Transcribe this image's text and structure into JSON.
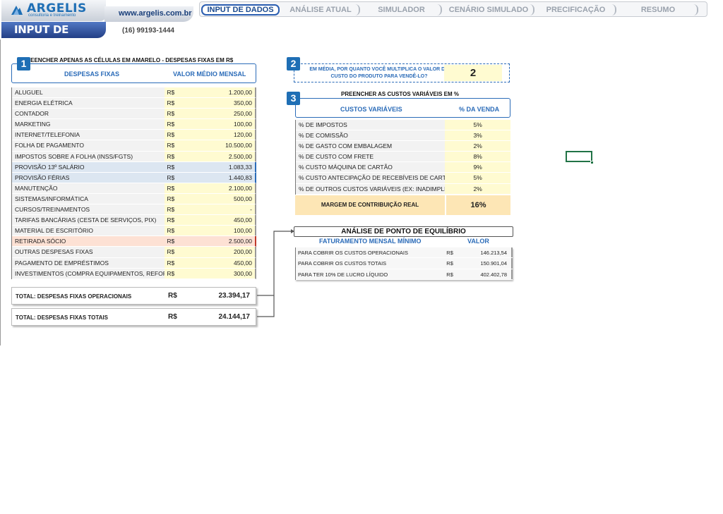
{
  "header": {
    "logo_text": "ARGELIS",
    "logo_subtext": "consultoria e treinamento",
    "website": "www.argelis.com.br",
    "page_title": "INPUT DE DADOS",
    "phone": "(16) 99193-1444"
  },
  "tabs": [
    {
      "label": "INPUT DE DADOS",
      "active": true
    },
    {
      "label": "ANÁLISE ATUAL",
      "active": false
    },
    {
      "label": "SIMULADOR",
      "active": false
    },
    {
      "label": "CENÁRIO SIMULADO",
      "active": false
    },
    {
      "label": "PRECIFICAÇÃO",
      "active": false
    },
    {
      "label": "RESUMO",
      "active": false
    }
  ],
  "section1": {
    "number": "1",
    "title": "PREENCHER APENAS AS CÉLULAS EM AMARELO - DESPESAS FIXAS EM R$",
    "col_name": "DESPESAS FIXAS",
    "col_value": "VALOR MÉDIO MENSAL",
    "currency": "R$",
    "rows": [
      {
        "name": "ALUGUEL",
        "value": "1.200,00",
        "style": "yellow"
      },
      {
        "name": "ENERGIA ELÉTRICA",
        "value": "350,00",
        "style": "yellow"
      },
      {
        "name": "CONTADOR",
        "value": "250,00",
        "style": "yellow"
      },
      {
        "name": "MARKETING",
        "value": "100,00",
        "style": "yellow"
      },
      {
        "name": "INTERNET/TELEFONIA",
        "value": "120,00",
        "style": "yellow"
      },
      {
        "name": "FOLHA DE PAGAMENTO",
        "value": "10.500,00",
        "style": "yellow"
      },
      {
        "name": "IMPOSTOS SOBRE A FOLHA (INSS/FGTS)",
        "value": "2.500,00",
        "style": "yellow"
      },
      {
        "name": "PROVISÃO 13º SALÁRIO",
        "value": "1.083,33",
        "style": "blue"
      },
      {
        "name": "PROVISÃO FÉRIAS",
        "value": "1.440,83",
        "style": "blue"
      },
      {
        "name": "MANUTENÇÃO",
        "value": "2.100,00",
        "style": "yellow"
      },
      {
        "name": "SISTEMAS/INFORMÁTICA",
        "value": "500,00",
        "style": "yellow"
      },
      {
        "name": "CURSOS/TREINAMENTOS",
        "value": "-",
        "style": "yellow"
      },
      {
        "name": "TARIFAS BANCÁRIAS (CESTA DE SERVIÇOS, PIX)",
        "value": "450,00",
        "style": "yellow"
      },
      {
        "name": "MATERIAL DE ESCRITÓRIO",
        "value": "100,00",
        "style": "yellow"
      },
      {
        "name": "RETIRADA SÓCIO",
        "value": "2.500,00",
        "style": "red"
      },
      {
        "name": "OUTRAS DESPESAS FIXAS",
        "value": "200,00",
        "style": "yellow"
      },
      {
        "name": "PAGAMENTO DE EMPRÉSTIMOS",
        "value": "450,00",
        "style": "yellow"
      },
      {
        "name": "INVESTIMENTOS (COMPRA EQUIPAMENTOS, REFORMAS)",
        "value": "300,00",
        "style": "yellow"
      }
    ],
    "total_operational_label": "TOTAL: DESPESAS FIXAS OPERACIONAIS",
    "total_operational_value": "23.394,17",
    "total_label": "TOTAL: DESPESAS FIXAS TOTAIS",
    "total_value": "24.144,17"
  },
  "section2": {
    "number": "2",
    "question": "EM MÉDIA, POR QUANTO VOCÊ MULTIPLICA O VALOR DO CUSTO DO PRODUTO PARA VENDÊ-LO?",
    "value": "2"
  },
  "section3": {
    "number": "3",
    "title": "PREENCHER AS CUSTOS VARIÁVEIS EM %",
    "col_name": "CUSTOS VARIÁVEIS",
    "col_value": "% DA VENDA",
    "rows": [
      {
        "name": "% DE IMPOSTOS",
        "value": "5%"
      },
      {
        "name": "% DE COMISSÃO",
        "value": "3%"
      },
      {
        "name": "% DE GASTO COM EMBALAGEM",
        "value": "2%"
      },
      {
        "name": "% DE CUSTO COM FRETE",
        "value": "8%"
      },
      {
        "name": "% CUSTO MÁQUINA DE CARTÃO",
        "value": "9%"
      },
      {
        "name": "% CUSTO ANTECIPAÇÃO DE RECEBÍVEIS DE CARTÃO",
        "value": "5%"
      },
      {
        "name": "% DE OUTROS CUSTOS VARIÁVEIS (EX: INADIMPLÊNCIA)",
        "value": "2%"
      }
    ],
    "margin_label": "MARGEM DE CONTRIBUIÇÃO REAL",
    "margin_value": "16%"
  },
  "breakeven": {
    "title": "ANÁLISE DE PONTO DE EQUILÍBRIO",
    "col_name": "FATURAMENTO MENSAL MÍNIMO",
    "col_value": "VALOR",
    "currency": "R$",
    "rows": [
      {
        "name": "PARA COBRIR OS CUSTOS OPERACIONAIS",
        "value": "146.213,54"
      },
      {
        "name": "PARA COBRIR OS CUSTOS TOTAIS",
        "value": "150.901,04"
      },
      {
        "name": "PARA TER 10% DE LUCRO LÍQUIDO",
        "value": "402.402,78"
      }
    ]
  },
  "colors": {
    "accent_blue": "#2a6bb8",
    "input_yellow": "#fffbd1",
    "provision_blue": "#dce6f1",
    "partner_red": "#fde1d4",
    "margin_orange": "#fde6b5",
    "excel_green": "#217346"
  }
}
